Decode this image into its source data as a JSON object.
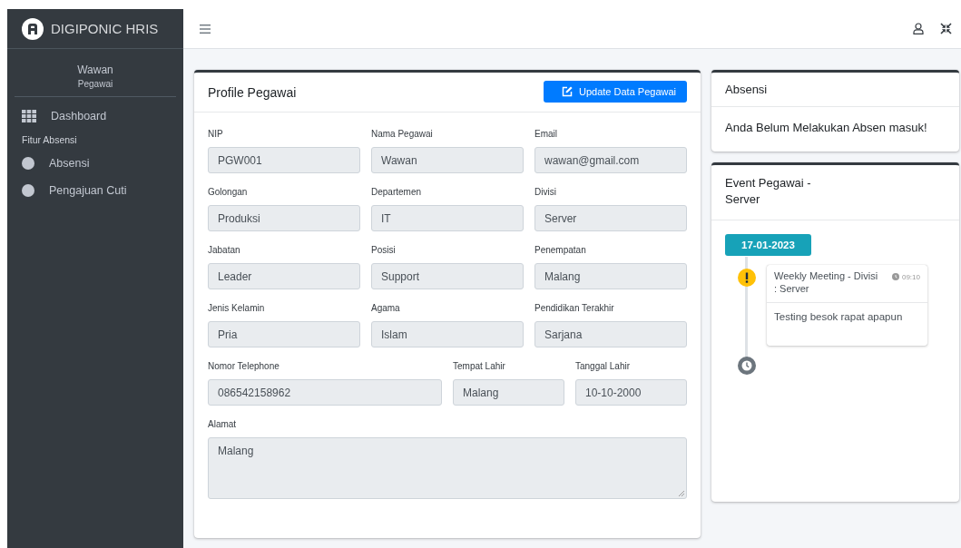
{
  "brand": {
    "title": "DIGIPONIC HRIS"
  },
  "user": {
    "name": "Wawan",
    "role": "Pegawai"
  },
  "sidebar": {
    "items": [
      {
        "kind": "grid-link",
        "label": "Dashboard"
      },
      {
        "kind": "section",
        "label": "Fitur Absensi"
      },
      {
        "kind": "dot-link",
        "label": "Absensi"
      },
      {
        "kind": "dot-link",
        "label": "Pengajuan Cuti"
      }
    ]
  },
  "profile": {
    "title": "Profile Pegawai",
    "button": "Update Data Pegawai",
    "rows": [
      {
        "kind": "triple",
        "fields": [
          {
            "label": "NIP",
            "value": "PGW001"
          },
          {
            "label": "Nama Pegawai",
            "value": "Wawan"
          },
          {
            "label": "Email",
            "value": "wawan@gmail.com"
          }
        ]
      },
      {
        "kind": "triple",
        "fields": [
          {
            "label": "Golongan",
            "value": "Produksi"
          },
          {
            "label": "Departemen",
            "value": "IT"
          },
          {
            "label": "Divisi",
            "value": "Server"
          }
        ]
      },
      {
        "kind": "triple",
        "fields": [
          {
            "label": "Jabatan",
            "value": "Leader"
          },
          {
            "label": "Posisi",
            "value": "Support"
          },
          {
            "label": "Penempatan",
            "value": "Malang"
          }
        ]
      },
      {
        "kind": "triple",
        "fields": [
          {
            "label": "Jenis Kelamin",
            "value": "Pria"
          },
          {
            "label": "Agama",
            "value": "Islam"
          },
          {
            "label": "Pendidikan Terakhir",
            "value": "Sarjana"
          }
        ]
      },
      {
        "kind": "contact",
        "fields": [
          {
            "label": "Nomor Telephone",
            "value": "086542158962"
          },
          {
            "label": "Tempat Lahir",
            "value": "Malang"
          },
          {
            "label": "Tanggal Lahir",
            "value": "10-10-2000"
          }
        ]
      },
      {
        "kind": "textarea",
        "fields": [
          {
            "label": "Alamat",
            "value": "Malang"
          }
        ]
      }
    ]
  },
  "absensi": {
    "title": "Absensi",
    "message": "Anda Belum Melakukan Absen masuk!"
  },
  "events": {
    "title": "Event Pegawai - Server",
    "date": "17-01-2023",
    "items": [
      {
        "title": "Weekly Meeting - Divisi : Server",
        "time": "09:10",
        "body": "Testing besok rapat apapun"
      }
    ]
  }
}
